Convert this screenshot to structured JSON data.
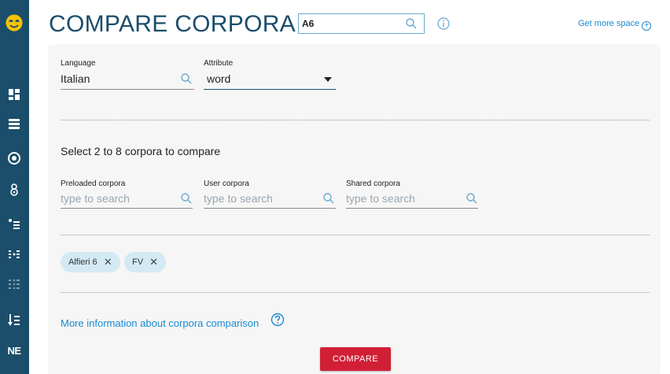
{
  "app": {
    "page_title": "COMPARE CORPORA",
    "search_value": "A6",
    "more_space_label": "Get more space",
    "more_space_icon": "plus-circle-icon",
    "accent_color": "#1b4e6b",
    "link_color": "#1b8ad1",
    "button_color": "#d11f36"
  },
  "sidebar": {
    "icons": [
      "dashboard-icon",
      "list-icon",
      "target-icon",
      "concordance-icon",
      "bullet-list-icon",
      "dots-list-icon",
      "dots-grid-icon",
      "sort-down-icon",
      "ne-icon"
    ],
    "ne_label": "NE"
  },
  "form": {
    "language_label": "Language",
    "language_value": "Italian",
    "attribute_label": "Attribute",
    "attribute_value": "word",
    "select_heading": "Select 2 to 8 corpora to compare",
    "preloaded_label": "Preloaded corpora",
    "user_label": "User corpora",
    "shared_label": "Shared corpora",
    "search_placeholder": "type to search",
    "chips": [
      "Alfieri 6",
      "FV"
    ],
    "more_info_link": "More information about corpora comparison",
    "compare_button": "COMPARE"
  }
}
